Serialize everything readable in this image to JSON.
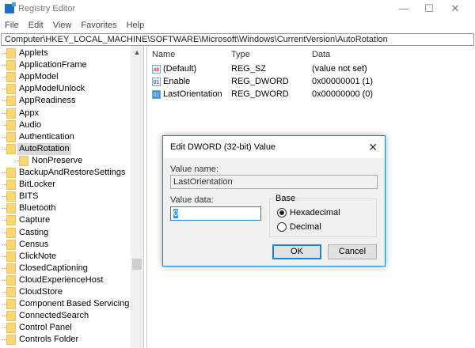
{
  "window": {
    "title": "Registry Editor",
    "minimize": "—",
    "maximize": "☐",
    "close": "✕"
  },
  "menu": [
    "File",
    "Edit",
    "View",
    "Favorites",
    "Help"
  ],
  "address": "Computer\\HKEY_LOCAL_MACHINE\\SOFTWARE\\Microsoft\\Windows\\CurrentVersion\\AutoRotation",
  "tree": [
    {
      "label": "Applets",
      "level": 0
    },
    {
      "label": "ApplicationFrame",
      "level": 0
    },
    {
      "label": "AppModel",
      "level": 0
    },
    {
      "label": "AppModelUnlock",
      "level": 0
    },
    {
      "label": "AppReadiness",
      "level": 0
    },
    {
      "label": "Appx",
      "level": 0
    },
    {
      "label": "Audio",
      "level": 0
    },
    {
      "label": "Authentication",
      "level": 0
    },
    {
      "label": "AutoRotation",
      "level": 0,
      "selected": true
    },
    {
      "label": "NonPreserve",
      "level": 1
    },
    {
      "label": "BackupAndRestoreSettings",
      "level": 0
    },
    {
      "label": "BitLocker",
      "level": 0
    },
    {
      "label": "BITS",
      "level": 0
    },
    {
      "label": "Bluetooth",
      "level": 0
    },
    {
      "label": "Capture",
      "level": 0
    },
    {
      "label": "Casting",
      "level": 0
    },
    {
      "label": "Census",
      "level": 0
    },
    {
      "label": "ClickNote",
      "level": 0
    },
    {
      "label": "ClosedCaptioning",
      "level": 0
    },
    {
      "label": "CloudExperienceHost",
      "level": 0
    },
    {
      "label": "CloudStore",
      "level": 0
    },
    {
      "label": "Component Based Servicing",
      "level": 0
    },
    {
      "label": "ConnectedSearch",
      "level": 0
    },
    {
      "label": "Control Panel",
      "level": 0
    },
    {
      "label": "Controls Folder",
      "level": 0
    }
  ],
  "list": {
    "headers": {
      "name": "Name",
      "type": "Type",
      "data": "Data"
    },
    "rows": [
      {
        "icon": "string-value-icon",
        "glyph": "ab",
        "name": "(Default)",
        "type": "REG_SZ",
        "data": "(value not set)"
      },
      {
        "icon": "binary-value-icon",
        "glyph": "01",
        "name": "Enable",
        "type": "REG_DWORD",
        "data": "0x00000001 (1)"
      },
      {
        "icon": "binary-value-icon",
        "glyph": "01",
        "name": "LastOrientation",
        "type": "REG_DWORD",
        "data": "0x00000000 (0)",
        "selected": true
      }
    ]
  },
  "dialog": {
    "title": "Edit DWORD (32-bit) Value",
    "close": "✕",
    "value_name_label": "Value name:",
    "value_name": "LastOrientation",
    "value_data_label": "Value data:",
    "value_data": "0",
    "base_label": "Base",
    "hex_label": "Hexadecimal",
    "dec_label": "Decimal",
    "base_selected": "Hexadecimal",
    "ok": "OK",
    "cancel": "Cancel"
  },
  "colors": {
    "accent": "#1883d7",
    "folder": "#f8d775"
  }
}
